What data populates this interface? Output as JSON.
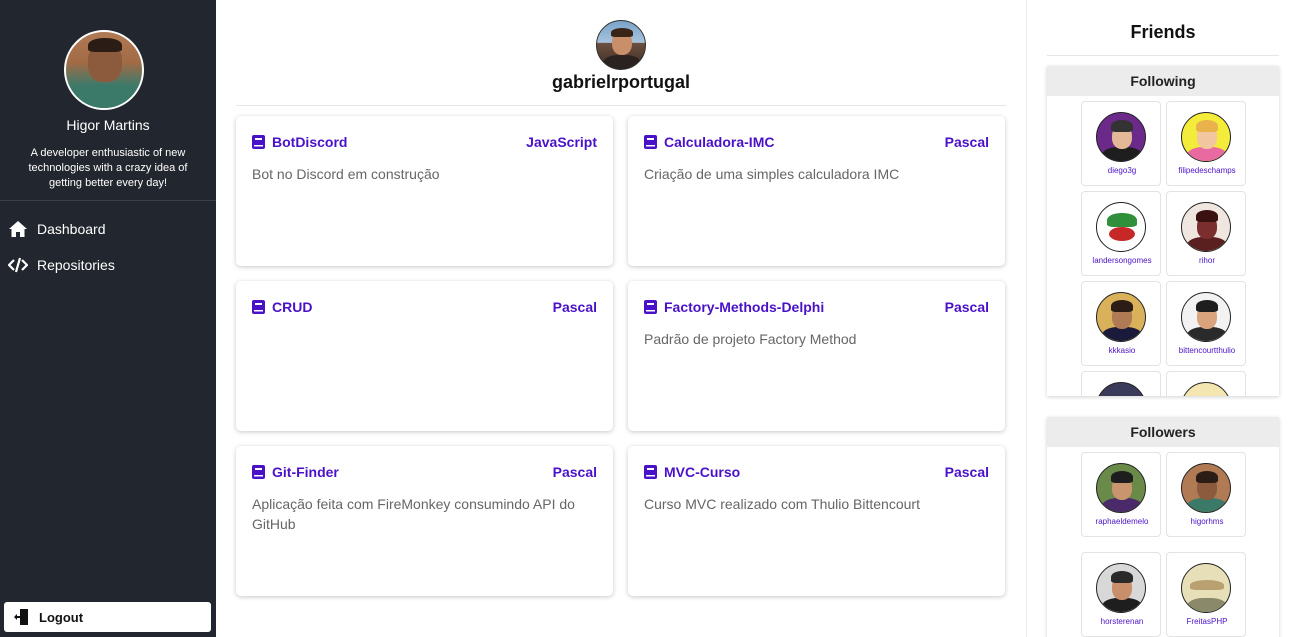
{
  "sidebar": {
    "profile_name": "Higor Martins",
    "bio": "A developer enthusiastic of new technologies with a crazy idea of getting better every day!",
    "nav": [
      {
        "label": "Dashboard",
        "icon": "home-icon"
      },
      {
        "label": "Repositories",
        "icon": "code-icon"
      }
    ],
    "logout_label": "Logout"
  },
  "main": {
    "username": "gabrielrportugal",
    "repos": [
      {
        "name": "BotDiscord",
        "language": "JavaScript",
        "description": "Bot no Discord em construção"
      },
      {
        "name": "Calculadora-IMC",
        "language": "Pascal",
        "description": "Criação de uma simples calculadora IMC"
      },
      {
        "name": "CRUD",
        "language": "Pascal",
        "description": ""
      },
      {
        "name": "Factory-Methods-Delphi",
        "language": "Pascal",
        "description": "Padrão de projeto Factory Method"
      },
      {
        "name": "Git-Finder",
        "language": "Pascal",
        "description": "Aplicação feita com FireMonkey consumindo API do GitHub"
      },
      {
        "name": "MVC-Curso",
        "language": "Pascal",
        "description": "Curso MVC realizado com Thulio Bittencourt"
      }
    ]
  },
  "friends": {
    "title": "Friends",
    "following_title": "Following",
    "following": [
      {
        "login": "diego3g"
      },
      {
        "login": "filipedeschamps"
      },
      {
        "login": "landersongomes"
      },
      {
        "login": "rihor"
      },
      {
        "login": "kkkasio"
      },
      {
        "login": "bittencourtthulio"
      }
    ],
    "followers_title": "Followers",
    "followers": [
      {
        "login": "raphaeldemelo"
      },
      {
        "login": "higorhms"
      },
      {
        "login": "horsterenan"
      },
      {
        "login": "FreitasPHP"
      }
    ]
  },
  "colors": {
    "sidebar_bg": "#22262e",
    "accent": "#4a12c8",
    "panel_header": "#ececec"
  }
}
